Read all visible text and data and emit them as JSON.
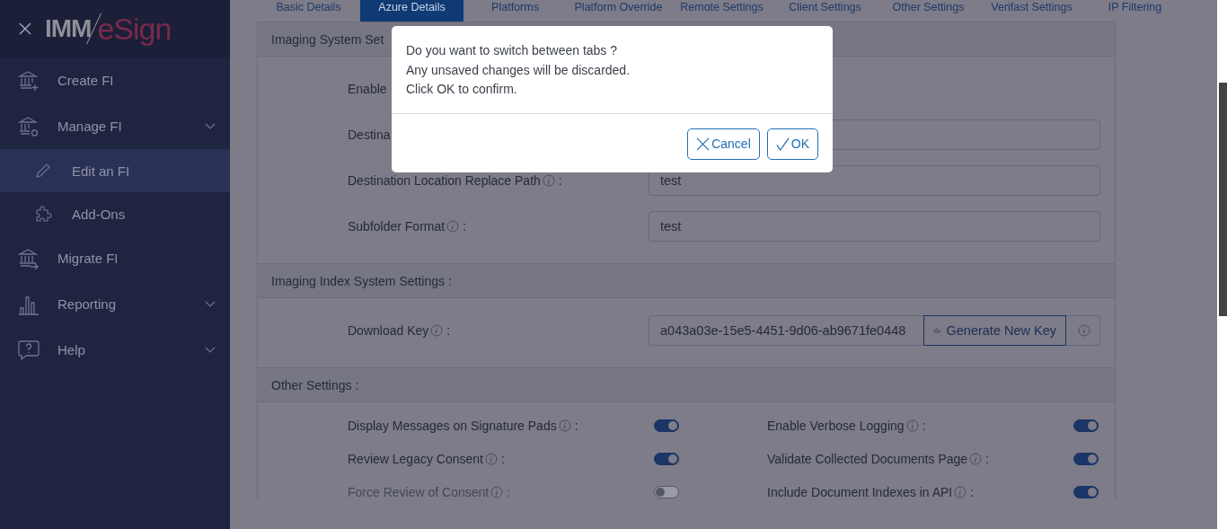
{
  "sidebar": {
    "logo": {
      "part_1": "IMM",
      "part_2": "eSign"
    },
    "items": [
      {
        "label": "Create FI",
        "selected": false
      },
      {
        "label": "Manage FI",
        "selected": false,
        "submenu": true,
        "expanded": true,
        "children": [
          {
            "label": "Edit an FI",
            "selected": true
          },
          {
            "label": "Add-Ons",
            "selected": false
          }
        ]
      },
      {
        "label": "Migrate FI",
        "selected": false
      },
      {
        "label": "Reporting",
        "selected": false,
        "submenu": true
      },
      {
        "label": "Help",
        "selected": false,
        "submenu": true
      }
    ]
  },
  "tabs": [
    {
      "label": "Basic Details",
      "selected": false
    },
    {
      "label": "Azure Details",
      "selected": true
    },
    {
      "label": "Platforms",
      "selected": false
    },
    {
      "label": "Platform Override",
      "selected": false
    },
    {
      "label": "Remote Settings",
      "selected": false
    },
    {
      "label": "Client Settings",
      "selected": false
    },
    {
      "label": "Other Settings",
      "selected": false
    },
    {
      "label": "Verifast Settings",
      "selected": false
    },
    {
      "label": "IP Filtering",
      "selected": false
    }
  ],
  "sections": [
    {
      "title": "Imaging System Set",
      "rows": [
        {
          "kind": "plain",
          "label": "Enable"
        },
        {
          "kind": "text",
          "label": "Destina"
        },
        {
          "kind": "text",
          "label": "Destination Location Replace Path",
          "info": true,
          "colon": ":",
          "value": "test"
        },
        {
          "kind": "text",
          "label": "Subfolder Format",
          "info": true,
          "colon": ":",
          "value": "test"
        }
      ]
    },
    {
      "title": "Imaging Index System Settings :",
      "rows": [
        {
          "kind": "key",
          "label": "Download Key",
          "info": true,
          "colon": ":",
          "value": "a043a03e-15e5-4451-9d06-ab9671fe0448",
          "button": "Generate New Key"
        }
      ]
    },
    {
      "title": "Other Settings :",
      "toggles": [
        {
          "label": "Display Messages on Signature Pads",
          "colon": ":",
          "on": true,
          "disabled": false
        },
        {
          "label": "Enable Verbose Logging",
          "colon": ":",
          "on": true,
          "disabled": false
        },
        {
          "label": "Review Legacy Consent",
          "colon": ":",
          "on": true,
          "disabled": false
        },
        {
          "label": "Validate Collected Documents Page",
          "colon": ":",
          "on": true,
          "disabled": false
        },
        {
          "label": "Force Review of Consent",
          "colon": ":",
          "on": false,
          "disabled": true
        },
        {
          "label": "Include Document Indexes in API",
          "colon": ":",
          "on": true,
          "disabled": false
        }
      ]
    }
  ],
  "dialog": {
    "lines": [
      "Do you want to switch between tabs ?",
      "Any unsaved changes will be discarded.",
      "Click OK to confirm."
    ],
    "buttons": [
      {
        "kind": "cancel",
        "label": "Cancel"
      },
      {
        "kind": "ok",
        "label": "OK"
      }
    ]
  }
}
